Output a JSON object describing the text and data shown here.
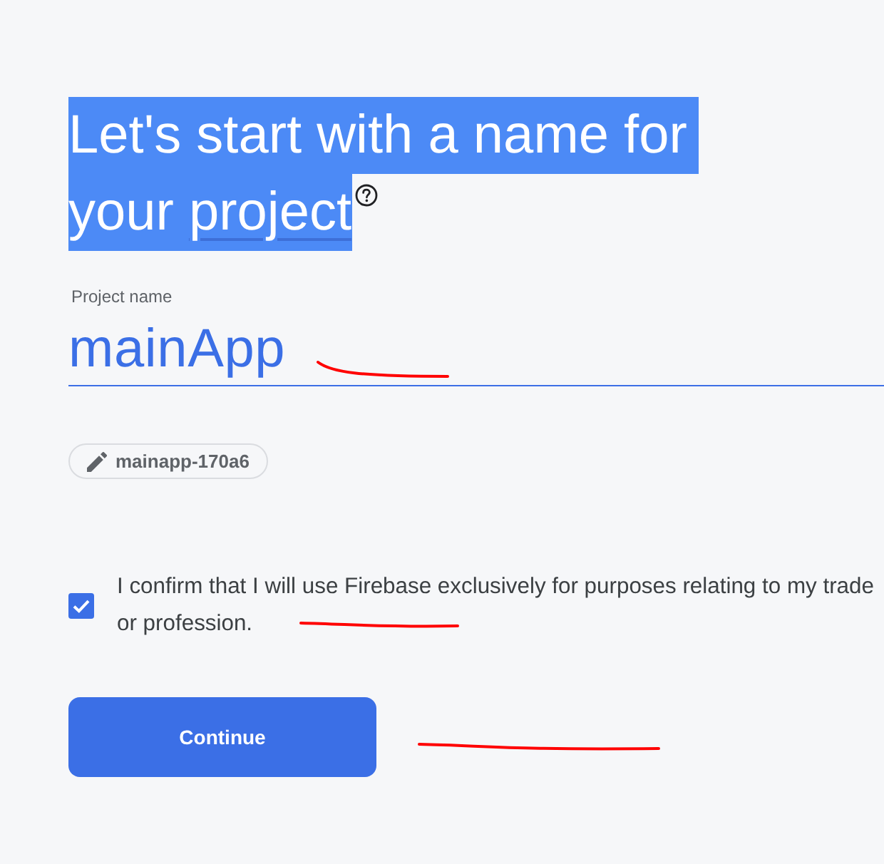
{
  "heading": {
    "lines": [
      "Let's start with a name for",
      "your"
    ],
    "term": "project",
    "highlighted": true
  },
  "project_name_field": {
    "label": "Project name",
    "value": "mainApp"
  },
  "project_id_chip": {
    "text": "mainapp-170a6"
  },
  "consent": {
    "lines": [
      "I confirm that I will use Firebase exclusively for purposes relating to my trade",
      "or profession."
    ],
    "checked": true
  },
  "continue_button": {
    "label": "Continue"
  }
}
